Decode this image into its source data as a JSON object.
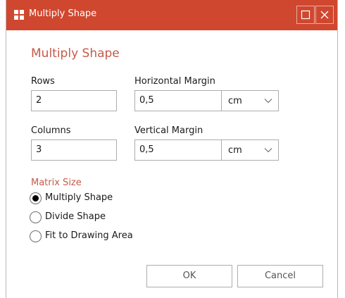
{
  "window": {
    "title": "Multiply Shape",
    "accent_color": "#d0472f",
    "icons": {
      "app": "shape-app-icon",
      "maximize": "maximize-icon",
      "close": "close-icon"
    }
  },
  "form": {
    "heading": "Multiply Shape",
    "rows": {
      "label": "Rows",
      "value": "2"
    },
    "columns": {
      "label": "Columns",
      "value": "3"
    },
    "horizontal_margin": {
      "label": "Horizontal Margin",
      "value": "0,5",
      "unit": "cm"
    },
    "vertical_margin": {
      "label": "Vertical Margin",
      "value": "0,5",
      "unit": "cm"
    }
  },
  "matrix_size": {
    "label": "Matrix Size",
    "options": [
      {
        "label": "Multiply Shape",
        "selected": true
      },
      {
        "label": "Divide Shape",
        "selected": false
      },
      {
        "label": "Fit to Drawing Area",
        "selected": false
      }
    ]
  },
  "buttons": {
    "ok": "OK",
    "cancel": "Cancel"
  }
}
